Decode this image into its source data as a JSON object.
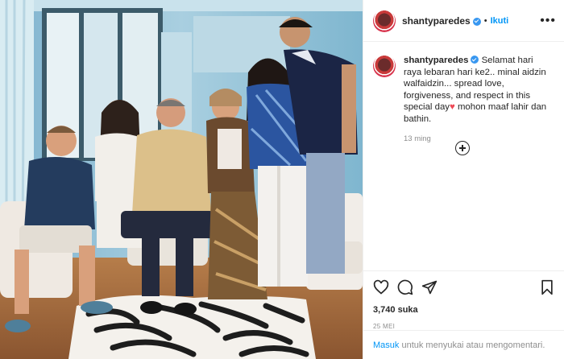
{
  "post": {
    "username": "shantyparedes",
    "follow_label": "Ikuti",
    "caption_text": "Selamat hari raya lebaran hari ke2.. minal aidzin walfaidzin... spread love, forgiveness, and respect in this special day",
    "caption_end": "mohon maaf lahir dan bathin.",
    "caption_emoji": "♥",
    "time_ago": "13 ming",
    "likes": "3,740 suka",
    "date": "25 MEI"
  },
  "footer": {
    "login_link": "Masuk",
    "login_text": " untuk menyukai atau mengomentari."
  },
  "icons": [
    "more-options-icon",
    "verified-badge-icon",
    "add-comment-icon",
    "heart-icon",
    "comment-icon",
    "share-icon",
    "bookmark-icon"
  ],
  "colors": {
    "link": "#0095f6",
    "verified": "#3897f0",
    "heart": "#ed4956",
    "muted": "#8e8e8e"
  }
}
